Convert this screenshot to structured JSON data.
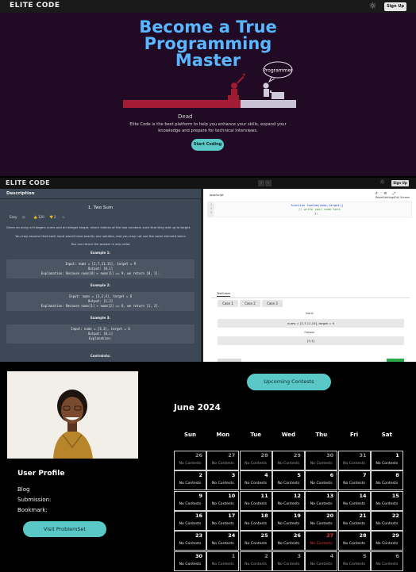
{
  "landing": {
    "logo": "ELITE CODE",
    "signup": "Sign Up",
    "title": "Become a True Programming Master",
    "speech": "Programmer",
    "dead_label": "Dead",
    "description": "Elite Code is the best platform to help you enhance your skills, expand your knowledge and prepare for technical interviews.",
    "cta": "Start Coding"
  },
  "problem_page": {
    "logo": "ELITE CODE",
    "signup": "Sign Up",
    "tab": "Description",
    "title": "1. Two Sum",
    "difficulty": "Easy",
    "likes": "120",
    "dislikes": "2",
    "statement": "Given an array of integers nums and an integer target, return indices of the two numbers such that they add up to target.",
    "assumption": "You may assume that each input would have exactly one solution, and you may not use the same element twice.",
    "order": "You can return the answer in any order.",
    "examples": [
      {
        "heading": "Example 1:",
        "input": "Input: nums = [2,7,11,15], target = 9",
        "output": "Output: [0,1]",
        "explanation": "Explanation: Because nums[0] + nums[1] == 9, we return [0, 1]."
      },
      {
        "heading": "Example 2:",
        "input": "Input: nums = [3,2,4], target = 6",
        "output": "Output: [1,2]",
        "explanation": "Explanation: Because nums[1] + nums[2] == 6, we return [1, 2]."
      },
      {
        "heading": "Example 3:",
        "input": "Input: nums = [3,3], target = 6",
        "output": "Output: [0,1]",
        "explanation": "Explanation:"
      }
    ],
    "constraints": "Contraints:",
    "language": "JavaScript",
    "editor_actions": "ResetSettingsFull Screen",
    "code_lines": [
      "function twoSum(nums,target){",
      "// write your code here",
      "};"
    ],
    "testcases_label": "TestCases",
    "cases": [
      "Case 1",
      "Case 2",
      "Case 3"
    ],
    "input_label": "Input:",
    "input_value": "nums = [2,7,11,15], target = 9",
    "output_label": "Output:",
    "output_value": "[0,1]"
  },
  "profile": {
    "upcoming": "Upcoming Contests",
    "name": "User Profile",
    "blog": "Blog",
    "submission": "Submission:",
    "bookmark": "Bookmark:",
    "visit": "Visit ProblemSet",
    "month": "June 2024",
    "weekdays": [
      "Sun",
      "Mon",
      "Tue",
      "Wed",
      "Thu",
      "Fri",
      "Sat"
    ],
    "no_contests": "No Contests",
    "days": [
      [
        "26",
        "27",
        "28",
        "29",
        "30",
        "31",
        "1"
      ],
      [
        "2",
        "3",
        "4",
        "5",
        "6",
        "7",
        "8"
      ],
      [
        "9",
        "10",
        "11",
        "12",
        "13",
        "14",
        "15"
      ],
      [
        "16",
        "17",
        "18",
        "19",
        "20",
        "21",
        "22"
      ],
      [
        "23",
        "24",
        "25",
        "26",
        "27",
        "28",
        "29"
      ],
      [
        "30",
        "1",
        "2",
        "3",
        "4",
        "5",
        "6"
      ]
    ],
    "today_color": "#e53935",
    "accent": "#5bc8c8"
  }
}
